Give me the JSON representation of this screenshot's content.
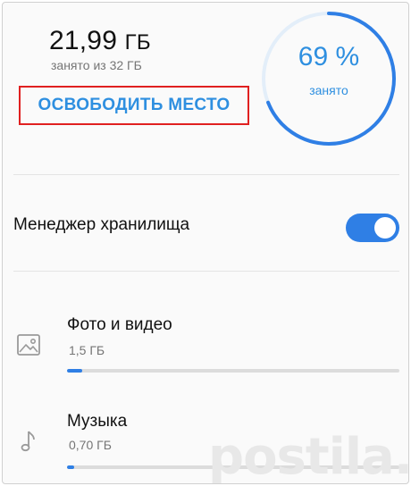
{
  "storage": {
    "used_value": "21,99",
    "used_unit": "ГБ",
    "used_of": "занято из 32 ГБ",
    "percent_label": "69 %",
    "percent_value": 69,
    "occupied_label": "занято",
    "free_button_label": "ОСВОБОДИТЬ МЕСТО"
  },
  "manager": {
    "label": "Менеджер хранилища",
    "enabled": true
  },
  "categories": [
    {
      "title": "Фото и видео",
      "size": "1,5 ГБ",
      "fill_fraction": 0.047,
      "icon": "image-icon"
    },
    {
      "title": "Музыка",
      "size": "0,70 ГБ",
      "fill_fraction": 0.022,
      "icon": "music-note-icon"
    }
  ],
  "watermark": "postila.ru",
  "colors": {
    "accent": "#2f7fe5",
    "highlight_border": "#e02020"
  }
}
